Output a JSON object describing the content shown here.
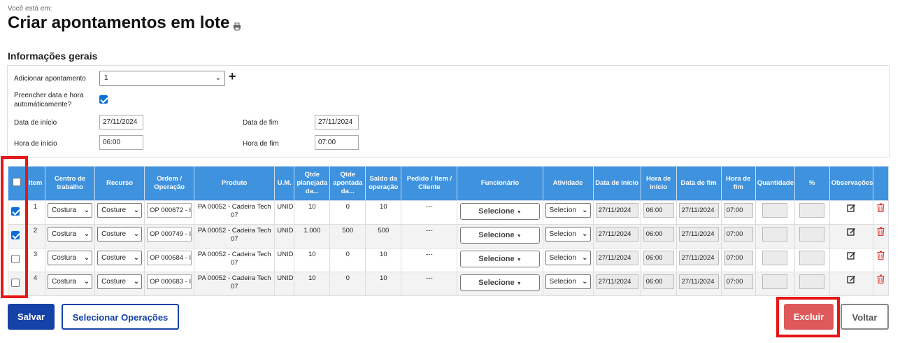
{
  "breadcrumb": "Você está em:",
  "page_title": "Criar apontamentos em lote",
  "section_title": "Informações gerais",
  "form": {
    "add_label": "Adicionar apontamento",
    "add_value": "1",
    "auto_label": "Preencher data e hora automáticamente?",
    "start_date_label": "Data de início",
    "start_date": "27/11/2024",
    "end_date_label": "Data de fim",
    "end_date": "27/11/2024",
    "start_time_label": "Hora de início",
    "start_time": "06:00",
    "end_time_label": "Hora de fim",
    "end_time": "07:00"
  },
  "headers": {
    "item": "Item",
    "centro": "Centro de trabalho",
    "recurso": "Recurso",
    "ordem": "Ordem / Operação",
    "produto": "Produto",
    "um": "U.M.",
    "qtde_plan": "Qtde planejada da...",
    "qtde_apont": "Qtde apontada da...",
    "saldo": "Saldo da operação",
    "pedido": "Pedido / Item / Cliente",
    "funcionario": "Funcionário",
    "atividade": "Atividade",
    "data_inicio": "Data de início",
    "hora_inicio": "Hora de início",
    "data_fim": "Data de fim",
    "hora_fim": "Hora de fim",
    "quantidade": "Quantidade",
    "pct": "%",
    "obs": "Observações"
  },
  "rows": [
    {
      "item": "1",
      "centro": "Costura",
      "recurso": "Costure",
      "ordem": "OP 000672 - I",
      "produto": "PA 00052 - Cadeira Tech 07",
      "um": "UNID",
      "qtde_plan": "10",
      "qtde_apont": "0",
      "saldo": "10",
      "pedido": "---",
      "funcionario": "Selecione",
      "atividade": "Selecion",
      "data_inicio": "27/11/2024",
      "hora_inicio": "06:00",
      "data_fim": "27/11/2024",
      "hora_fim": "07:00",
      "checked": true
    },
    {
      "item": "2",
      "centro": "Costura",
      "recurso": "Costure",
      "ordem": "OP 000749 - I",
      "produto": "PA 00052 - Cadeira Tech 07",
      "um": "UNID",
      "qtde_plan": "1.000",
      "qtde_apont": "500",
      "saldo": "500",
      "pedido": "---",
      "funcionario": "Selecione",
      "atividade": "Selecion",
      "data_inicio": "27/11/2024",
      "hora_inicio": "06:00",
      "data_fim": "27/11/2024",
      "hora_fim": "07:00",
      "checked": true
    },
    {
      "item": "3",
      "centro": "Costura",
      "recurso": "Costure",
      "ordem": "OP 000684 - I",
      "produto": "PA 00052 - Cadeira Tech 07",
      "um": "UNID",
      "qtde_plan": "10",
      "qtde_apont": "0",
      "saldo": "10",
      "pedido": "---",
      "funcionario": "Selecione",
      "atividade": "Selecion",
      "data_inicio": "27/11/2024",
      "hora_inicio": "06:00",
      "data_fim": "27/11/2024",
      "hora_fim": "07:00",
      "checked": false
    },
    {
      "item": "4",
      "centro": "Costura",
      "recurso": "Costure",
      "ordem": "OP 000683 - I",
      "produto": "PA 00052 - Cadeira Tech 07",
      "um": "UNID",
      "qtde_plan": "10",
      "qtde_apont": "0",
      "saldo": "10",
      "pedido": "---",
      "funcionario": "Selecione",
      "atividade": "Selecion",
      "data_inicio": "27/11/2024",
      "hora_inicio": "06:00",
      "data_fim": "27/11/2024",
      "hora_fim": "07:00",
      "checked": false
    }
  ],
  "buttons": {
    "salvar": "Salvar",
    "selecionar": "Selecionar Operações",
    "excluir": "Excluir",
    "voltar": "Voltar"
  },
  "icons": {
    "print": "print-icon",
    "edit": "edit-icon",
    "trash": "trash-icon",
    "chevron": "chevron-down-icon",
    "plus": "plus-icon"
  },
  "colors": {
    "header_bg": "#3f92de",
    "primary": "#1542a6",
    "danger": "#de5a5a",
    "highlight": "#e51717"
  }
}
